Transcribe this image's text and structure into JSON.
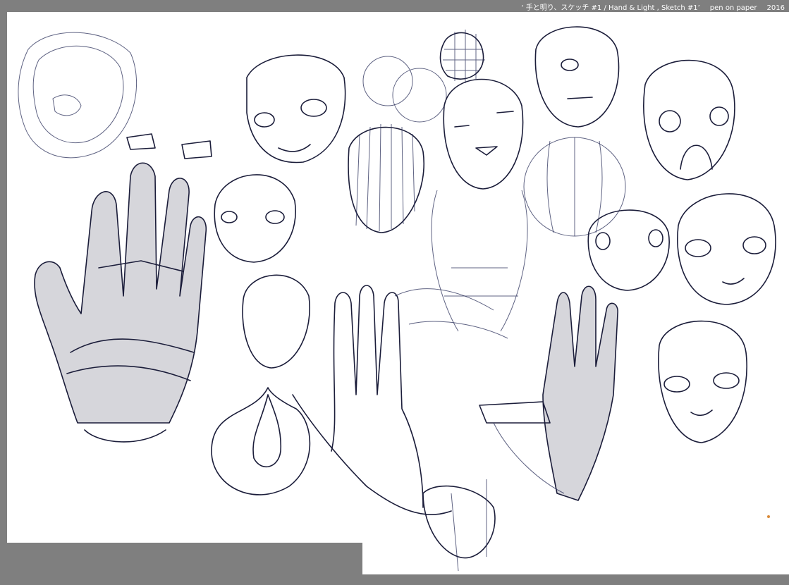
{
  "caption": {
    "title": "‘ 手と明り、スケッチ #1 / Hand & Light , Sketch #1’",
    "medium": "pen on paper",
    "year": "2016"
  },
  "colors": {
    "background": "#7f7f7f",
    "paper": "#ffffff",
    "ink": "#1b1d3a"
  }
}
